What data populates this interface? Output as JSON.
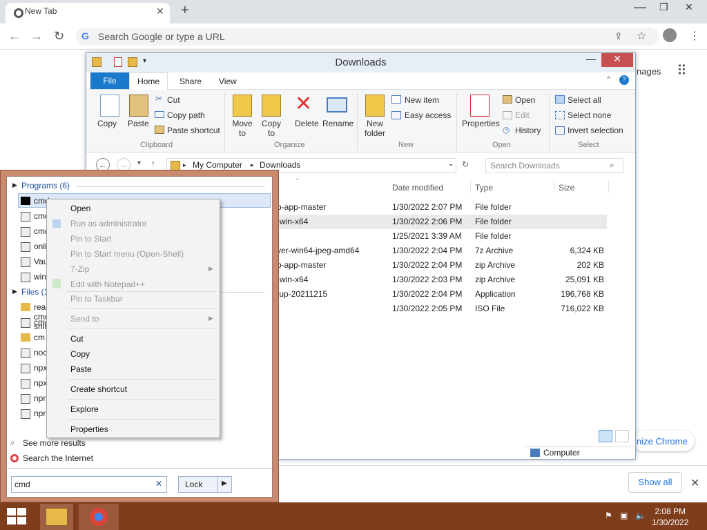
{
  "chrome": {
    "tab_title": "New Tab",
    "omnibox_placeholder": "Search Google or type a URL",
    "images_fragment": "nages",
    "customize_fragment": "nize Chrome",
    "show_all": "Show all"
  },
  "explorer": {
    "title": "Downloads",
    "tabs": [
      "File",
      "Home",
      "Share",
      "View"
    ],
    "clipboard": {
      "copy": "Copy",
      "paste": "Paste",
      "cut": "Cut",
      "copy_path": "Copy path",
      "paste_shortcut": "Paste shortcut",
      "label": "Clipboard"
    },
    "organize": {
      "move_to": "Move to",
      "copy_to": "Copy to",
      "delete": "Delete",
      "rename": "Rename",
      "label": "Organize"
    },
    "new": {
      "new_folder": "New folder",
      "new_item": "New item",
      "easy_access": "Easy access",
      "label": "New"
    },
    "open": {
      "properties": "Properties",
      "open": "Open",
      "edit": "Edit",
      "history": "History",
      "label": "Open"
    },
    "select": {
      "select_all": "Select all",
      "select_none": "Select none",
      "invert": "Invert selection",
      "label": "Select"
    },
    "path": [
      "My Computer",
      "Downloads"
    ],
    "search_placeholder": "Search Downloads",
    "columns": {
      "date": "Date modified",
      "type": "Type",
      "size": "Size"
    },
    "rows": [
      {
        "name": "b-app-master",
        "date": "1/30/2022 2:07 PM",
        "type": "File folder",
        "size": ""
      },
      {
        "name": "-win-x64",
        "date": "1/30/2022 2:06 PM",
        "type": "File folder",
        "size": ""
      },
      {
        "name": "",
        "date": "1/25/2021 3:39 AM",
        "type": "File folder",
        "size": ""
      },
      {
        "name": "ver-win64-jpeg-amd64",
        "date": "1/30/2022 2:04 PM",
        "type": "7z Archive",
        "size": "6,324 KB"
      },
      {
        "name": "b-app-master",
        "date": "1/30/2022 2:04 PM",
        "type": "zip Archive",
        "size": "202 KB"
      },
      {
        "name": "-win-x64",
        "date": "1/30/2022 2:03 PM",
        "type": "zip Archive",
        "size": "25,091 KB"
      },
      {
        "name": "tup-20211215",
        "date": "1/30/2022 2:04 PM",
        "type": "Application",
        "size": "196,768 KB"
      },
      {
        "name": "",
        "date": "1/30/2022 2:05 PM",
        "type": "ISO File",
        "size": "716,022 KB"
      }
    ],
    "status": "Computer"
  },
  "startmenu": {
    "programs_header": "Programs (6)",
    "programs": [
      "cmd",
      "cmdkey",
      "cmdl32",
      "onlinesetup",
      "VaultCmd",
      "winrm"
    ],
    "files_header": "Files (100)",
    "files": [
      "read-cmd-shim",
      "cmd",
      "cm",
      "noc",
      "npx",
      "npx",
      "npr",
      "npr"
    ],
    "see_more": "See more results",
    "search_internet": "Search the Internet",
    "search_value": "cmd",
    "lock": "Lock"
  },
  "context_menu": {
    "open": "Open",
    "run_admin": "Run as administrator",
    "pin_start": "Pin to Start",
    "pin_start_menu": "Pin to Start menu (Open-Shell)",
    "zip": "7-Zip",
    "notepad": "Edit with Notepad++",
    "pin_taskbar": "Pin to Taskbar",
    "send_to": "Send to",
    "cut": "Cut",
    "copy": "Copy",
    "paste": "Paste",
    "create_shortcut": "Create shortcut",
    "explore": "Explore",
    "properties": "Properties"
  },
  "taskbar": {
    "time": "2:08 PM",
    "date": "1/30/2022"
  }
}
